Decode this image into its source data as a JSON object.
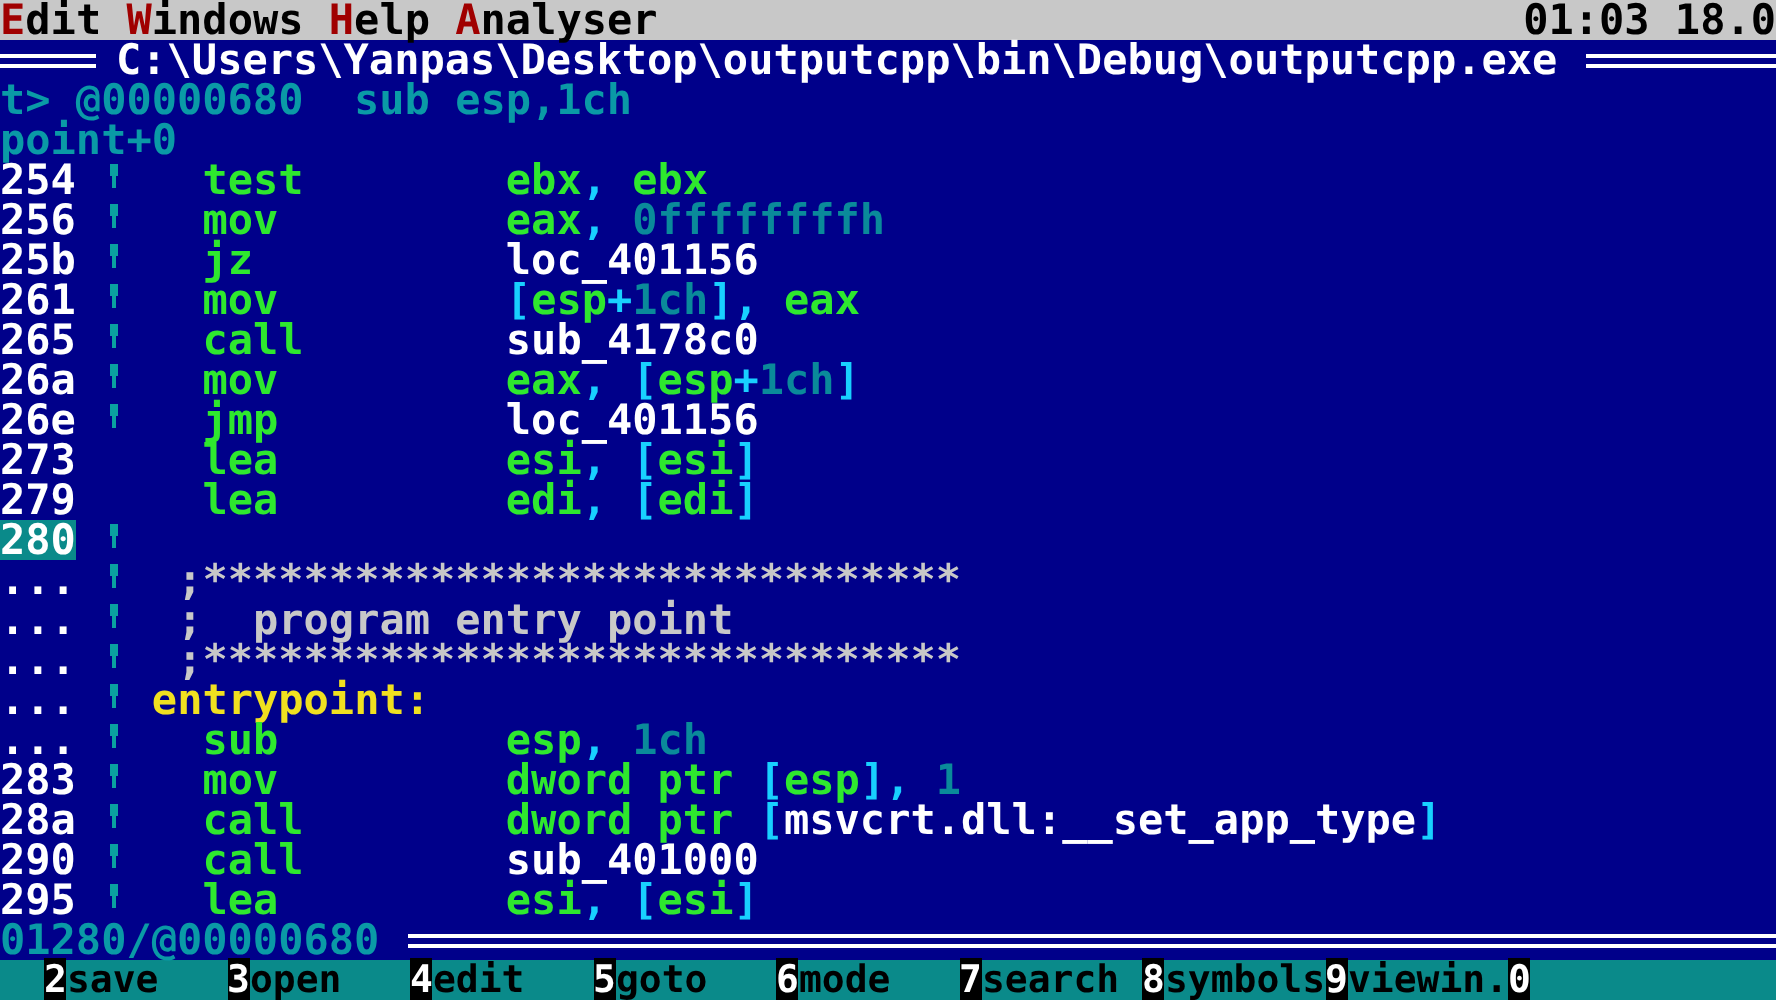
{
  "menu": {
    "items": [
      {
        "hotkey": "E",
        "rest": "dit"
      },
      {
        "hotkey": "W",
        "rest": "indows"
      },
      {
        "hotkey": "H",
        "rest": "elp"
      },
      {
        "hotkey": "A",
        "rest": "nalyser"
      }
    ],
    "clock": "01:03 18.0"
  },
  "title": "C:\\Users\\Yanpas\\Desktop\\outputcpp\\bin\\Debug\\outputcpp.exe",
  "location": "t> @00000680  sub esp,1ch",
  "symbol": "point+0",
  "lines": [
    {
      "kind": "instr",
      "address": "254",
      "marker": true,
      "selected": false,
      "mnemonic": "test",
      "operands": [
        {
          "t": "ebx",
          "kind": "reg"
        },
        {
          "t": ", ",
          "kind": "br"
        },
        {
          "t": "ebx",
          "kind": "reg"
        }
      ]
    },
    {
      "kind": "instr",
      "address": "256",
      "marker": true,
      "selected": false,
      "mnemonic": "mov",
      "operands": [
        {
          "t": "eax",
          "kind": "reg"
        },
        {
          "t": ", ",
          "kind": "br"
        },
        {
          "t": "0ffffffffh",
          "kind": "num"
        }
      ]
    },
    {
      "kind": "instr",
      "address": "25b",
      "marker": true,
      "selected": false,
      "mnemonic": "jz",
      "operands": [
        {
          "t": "loc_401156",
          "kind": "sym"
        }
      ]
    },
    {
      "kind": "instr",
      "address": "261",
      "marker": true,
      "selected": false,
      "mnemonic": "mov",
      "operands": [
        {
          "t": "[",
          "kind": "br"
        },
        {
          "t": "esp",
          "kind": "reg"
        },
        {
          "t": "+",
          "kind": "br"
        },
        {
          "t": "1ch",
          "kind": "num"
        },
        {
          "t": "], ",
          "kind": "br"
        },
        {
          "t": "eax",
          "kind": "reg"
        }
      ]
    },
    {
      "kind": "instr",
      "address": "265",
      "marker": true,
      "selected": false,
      "mnemonic": "call",
      "operands": [
        {
          "t": "sub_4178c0",
          "kind": "sym"
        }
      ]
    },
    {
      "kind": "instr",
      "address": "26a",
      "marker": true,
      "selected": false,
      "mnemonic": "mov",
      "operands": [
        {
          "t": "eax",
          "kind": "reg"
        },
        {
          "t": ", [",
          "kind": "br"
        },
        {
          "t": "esp",
          "kind": "reg"
        },
        {
          "t": "+",
          "kind": "br"
        },
        {
          "t": "1ch",
          "kind": "num"
        },
        {
          "t": "]",
          "kind": "br"
        }
      ]
    },
    {
      "kind": "instr",
      "address": "26e",
      "marker": true,
      "selected": false,
      "mnemonic": "jmp",
      "operands": [
        {
          "t": "loc_401156",
          "kind": "sym"
        }
      ]
    },
    {
      "kind": "instr",
      "address": "273",
      "marker": false,
      "selected": false,
      "mnemonic": "lea",
      "operands": [
        {
          "t": "esi",
          "kind": "reg"
        },
        {
          "t": ", [",
          "kind": "br"
        },
        {
          "t": "esi",
          "kind": "reg"
        },
        {
          "t": "]",
          "kind": "br"
        }
      ]
    },
    {
      "kind": "instr",
      "address": "279",
      "marker": false,
      "selected": false,
      "mnemonic": "lea",
      "operands": [
        {
          "t": "edi",
          "kind": "reg"
        },
        {
          "t": ", [",
          "kind": "br"
        },
        {
          "t": "edi",
          "kind": "reg"
        },
        {
          "t": "]",
          "kind": "br"
        }
      ]
    },
    {
      "kind": "blank",
      "address": "280",
      "marker": true,
      "selected": true
    },
    {
      "kind": "comment",
      "address": "...",
      "marker": true,
      "selected": false,
      "text": ";******************************"
    },
    {
      "kind": "comment",
      "address": "...",
      "marker": true,
      "selected": false,
      "text": ";  program entry point"
    },
    {
      "kind": "comment",
      "address": "...",
      "marker": true,
      "selected": false,
      "text": ";******************************"
    },
    {
      "kind": "label",
      "address": "...",
      "marker": true,
      "selected": false,
      "text": "entrypoint:"
    },
    {
      "kind": "instr",
      "address": "...",
      "marker": true,
      "selected": false,
      "mnemonic": "sub",
      "operands": [
        {
          "t": "esp",
          "kind": "reg"
        },
        {
          "t": ", ",
          "kind": "br"
        },
        {
          "t": "1ch",
          "kind": "num"
        }
      ]
    },
    {
      "kind": "instr",
      "address": "283",
      "marker": true,
      "selected": false,
      "mnemonic": "mov",
      "operands": [
        {
          "t": "dword ptr ",
          "kind": "reg"
        },
        {
          "t": "[",
          "kind": "br"
        },
        {
          "t": "esp",
          "kind": "reg"
        },
        {
          "t": "], ",
          "kind": "br"
        },
        {
          "t": "1",
          "kind": "num"
        }
      ]
    },
    {
      "kind": "instr",
      "address": "28a",
      "marker": true,
      "selected": false,
      "mnemonic": "call",
      "operands": [
        {
          "t": "dword ptr ",
          "kind": "reg"
        },
        {
          "t": "[",
          "kind": "br"
        },
        {
          "t": "msvcrt.dll:__set_app_type",
          "kind": "sym"
        },
        {
          "t": "]",
          "kind": "br"
        }
      ]
    },
    {
      "kind": "instr",
      "address": "290",
      "marker": true,
      "selected": false,
      "mnemonic": "call",
      "operands": [
        {
          "t": "sub_401000",
          "kind": "sym"
        }
      ]
    },
    {
      "kind": "instr",
      "address": "295",
      "marker": true,
      "selected": false,
      "mnemonic": "lea",
      "operands": [
        {
          "t": "esi",
          "kind": "reg"
        },
        {
          "t": ", [",
          "kind": "br"
        },
        {
          "t": "esi",
          "kind": "reg"
        },
        {
          "t": "]",
          "kind": "br"
        }
      ]
    }
  ],
  "status": "01280/@00000680",
  "function_keys": [
    {
      "key": "2",
      "label": "save"
    },
    {
      "key": "3",
      "label": "open"
    },
    {
      "key": "4",
      "label": "edit"
    },
    {
      "key": "5",
      "label": "goto"
    },
    {
      "key": "6",
      "label": "mode"
    },
    {
      "key": "7",
      "label": "search"
    },
    {
      "key": "8",
      "label": "symbols"
    },
    {
      "key": "9",
      "label": "viewin."
    },
    {
      "key": "0"
    }
  ]
}
